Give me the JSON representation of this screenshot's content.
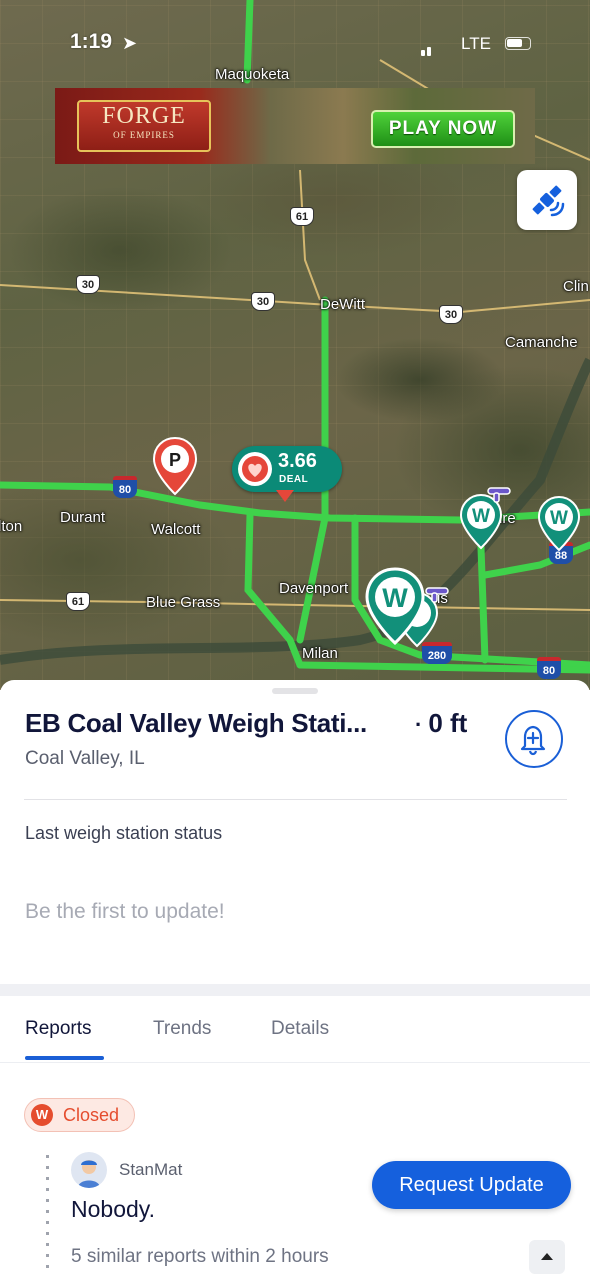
{
  "status_bar": {
    "time": "1:19",
    "network": "LTE"
  },
  "ad": {
    "brand_line1": "FORGE",
    "brand_line2": "OF EMPIRES",
    "cta": "PLAY NOW"
  },
  "map": {
    "places": [
      "Maquoketa",
      "DeWitt",
      "Camanche",
      "Clin",
      "Durant",
      "Walcott",
      "Davenport",
      "Blue Grass",
      "Milan",
      "lton",
      "ire",
      "is"
    ],
    "route_shields": [
      "61",
      "30",
      "30",
      "30",
      "61"
    ],
    "interstate_shields": [
      "80",
      "88",
      "280",
      "80"
    ],
    "deal_pin": {
      "price": "3.66",
      "label": "DEAL"
    },
    "colors": {
      "road": "#3fd24b",
      "weigh_station": "#12907a",
      "parking": "#e5473a"
    }
  },
  "station": {
    "title": "EB Coal Valley Weigh Stati...",
    "separator": "·",
    "distance": "0 ft",
    "location": "Coal Valley, IL",
    "last_status_label": "Last weigh station status",
    "empty_prompt": "Be the first to update!"
  },
  "tabs": [
    {
      "label": "Reports",
      "active": true
    },
    {
      "label": "Trends",
      "active": false
    },
    {
      "label": "Details",
      "active": false
    }
  ],
  "report": {
    "badge_letter": "W",
    "status": "Closed",
    "user": "StanMat",
    "text": "Nobody.",
    "similar": "5 similar reports within 2 hours"
  },
  "actions": {
    "request_update": "Request Update"
  },
  "colors": {
    "primary": "#1560dd",
    "closed": "#e54d2e",
    "title": "#11163a"
  }
}
